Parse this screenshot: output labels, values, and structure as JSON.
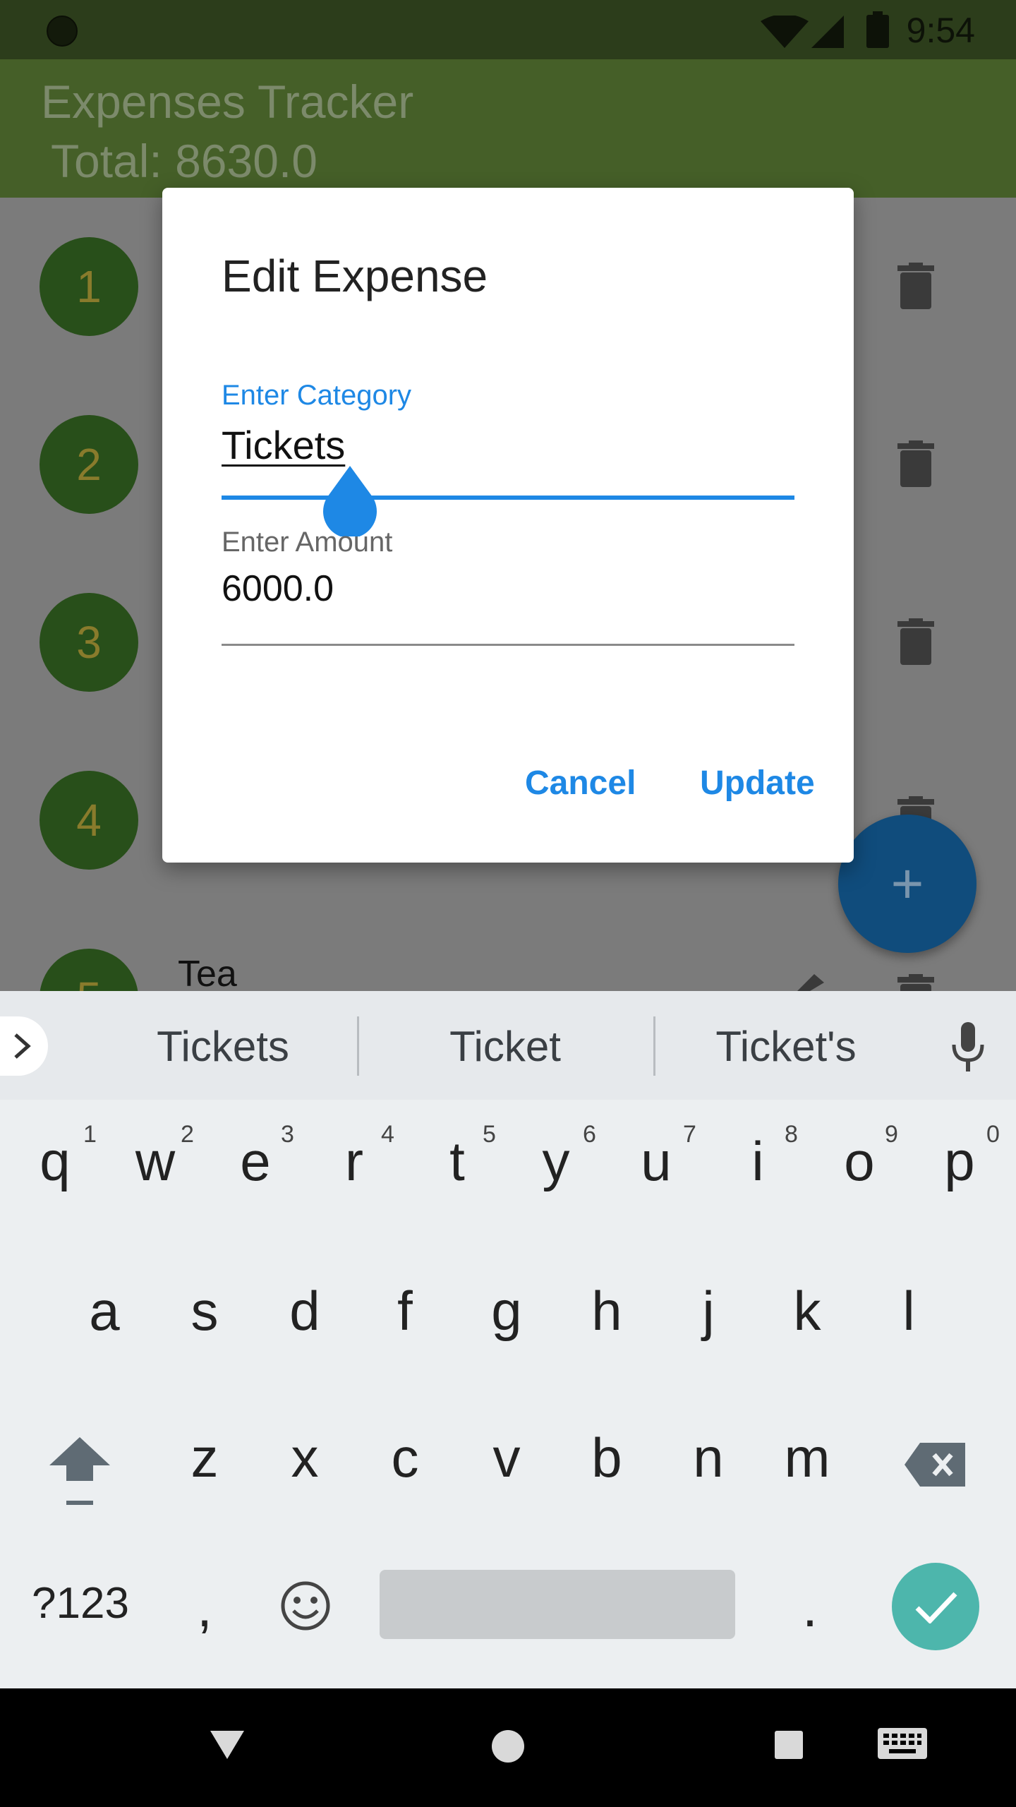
{
  "status_bar": {
    "time": "9:54"
  },
  "app_bar": {
    "title": "Expenses Tracker",
    "total": "Total: 8630.0"
  },
  "list": {
    "rows": [
      {
        "index": "1"
      },
      {
        "index": "2"
      },
      {
        "index": "3"
      },
      {
        "index": "4"
      },
      {
        "index": "5",
        "label": "Tea"
      }
    ]
  },
  "fab": {
    "icon": "plus-icon",
    "label": "+"
  },
  "dialog": {
    "title": "Edit Expense",
    "category_label": "Enter Category",
    "category_value": "Tickets",
    "amount_label": "Enter Amount",
    "amount_value": "6000.0",
    "cancel": "Cancel",
    "update": "Update"
  },
  "suggestions": [
    "Tickets",
    "Ticket",
    "Ticket's"
  ],
  "keyboard": {
    "row1": [
      "q",
      "w",
      "e",
      "r",
      "t",
      "y",
      "u",
      "i",
      "o",
      "p"
    ],
    "row1_hints": [
      "1",
      "2",
      "3",
      "4",
      "5",
      "6",
      "7",
      "8",
      "9",
      "0"
    ],
    "row2": [
      "a",
      "s",
      "d",
      "f",
      "g",
      "h",
      "j",
      "k",
      "l"
    ],
    "row3": [
      "z",
      "x",
      "c",
      "v",
      "b",
      "n",
      "m"
    ],
    "symbols_key": "?123",
    "comma_key": ",",
    "period_key": "."
  },
  "colors": {
    "accent": "#1e88e5",
    "app_bar": "#455f28",
    "enter_key": "#4db6ac"
  }
}
